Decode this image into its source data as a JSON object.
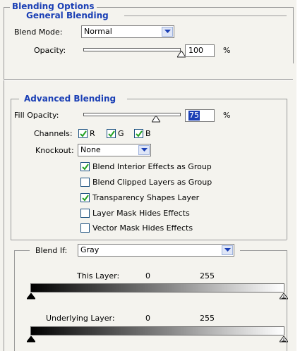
{
  "blending_options": {
    "title": "Blending Options",
    "general": {
      "title": "General Blending",
      "blend_mode_label": "Blend Mode:",
      "blend_mode_value": "Normal",
      "opacity_label": "Opacity:",
      "opacity_value": "100",
      "opacity_unit": "%",
      "opacity_level": 1.0
    },
    "advanced": {
      "title": "Advanced Blending",
      "fill_opacity_label": "Fill Opacity:",
      "fill_opacity_value": "75",
      "fill_opacity_unit": "%",
      "fill_opacity_level": 0.75,
      "channels_label": "Channels:",
      "channels": [
        {
          "label": "R",
          "checked": true
        },
        {
          "label": "G",
          "checked": true
        },
        {
          "label": "B",
          "checked": true
        }
      ],
      "knockout_label": "Knockout:",
      "knockout_value": "None",
      "options": [
        {
          "label": "Blend Interior Effects as Group",
          "checked": true
        },
        {
          "label": "Blend Clipped Layers as Group",
          "checked": false
        },
        {
          "label": "Transparency Shapes Layer",
          "checked": true
        },
        {
          "label": "Layer Mask Hides Effects",
          "checked": false
        },
        {
          "label": "Vector Mask Hides Effects",
          "checked": false
        }
      ]
    },
    "blend_if": {
      "label": "Blend If:",
      "value": "Gray",
      "this_layer_label": "This Layer:",
      "this_layer_min": "0",
      "this_layer_max": "255",
      "underlying_label": "Underlying Layer:",
      "underlying_min": "0",
      "underlying_max": "255"
    }
  },
  "colors": {
    "accent": "#1a3fb5",
    "panel_bg": "#f4f3ee",
    "check": "#21a121"
  }
}
